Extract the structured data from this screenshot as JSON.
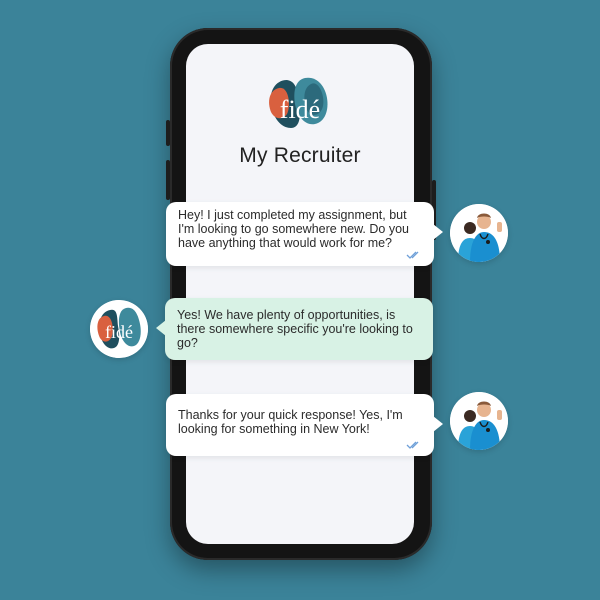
{
  "app": {
    "brand": "fidé",
    "title": "My Recruiter"
  },
  "messages": [
    {
      "sender": "user",
      "text": "Hey! I just completed my assignment, but I'm looking to go somewhere new. Do you have anything that would work for me?",
      "status": "read",
      "avatar_icon": "nurses-avatar-icon"
    },
    {
      "sender": "recruiter",
      "text": "Yes! We have plenty of opportunities, is there somewhere specific you're looking to go?",
      "avatar_icon": "fide-logo-avatar-icon"
    },
    {
      "sender": "user",
      "text": "Thanks for your quick response! Yes, I'm looking for something in New York!",
      "status": "read",
      "avatar_icon": "nurses-avatar-icon"
    }
  ],
  "colors": {
    "background": "#3b8399",
    "brand_dark_teal": "#1f4f5e",
    "brand_orange": "#d9603f",
    "brand_teal": "#3e8a9c",
    "recruiter_bubble": "#d8f2e5",
    "user_bubble": "#ffffff",
    "read_check": "#6fa0d8"
  }
}
